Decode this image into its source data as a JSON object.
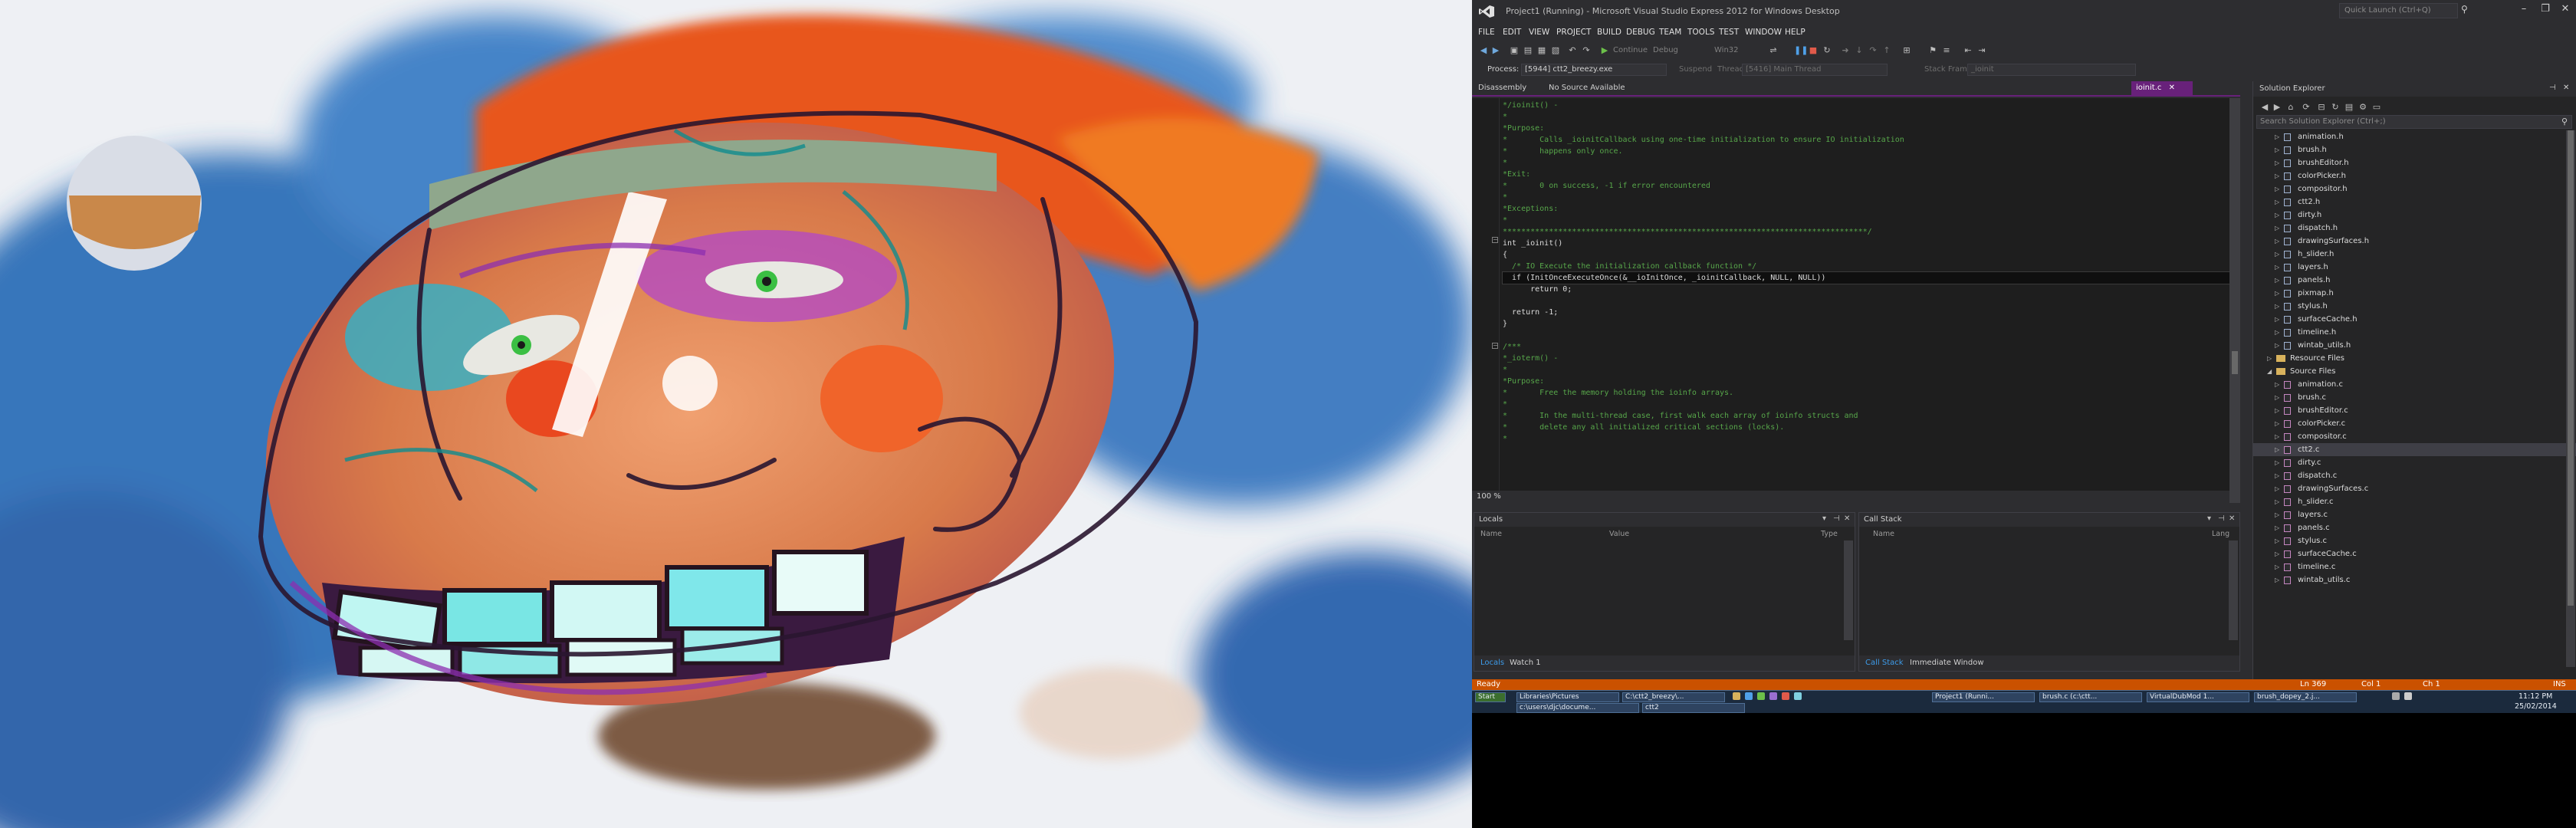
{
  "window": {
    "title": "Project1 (Running) - Microsoft Visual Studio Express 2012 for Windows Desktop",
    "quick_launch_placeholder": "Quick Launch (Ctrl+Q)"
  },
  "menu": [
    "FILE",
    "EDIT",
    "VIEW",
    "PROJECT",
    "BUILD",
    "DEBUG",
    "TEAM",
    "TOOLS",
    "TEST",
    "WINDOW",
    "HELP"
  ],
  "toolbar": {
    "continue_label": "Continue",
    "config": "Debug",
    "platform": "Win32",
    "process_label": "Process:",
    "process_value": "[5944] ctt2_breezy.exe",
    "suspend_label": "Suspend",
    "thread_label": "Thread:",
    "thread_value": "[5416] Main Thread",
    "stack_frame_label": "Stack Frame:",
    "stack_frame_value": "_ioinit"
  },
  "editor": {
    "tabs": [
      "Disassembly",
      "No Source Available"
    ],
    "active_tab": "ioinit.c",
    "zoom": "100 %",
    "lines": [
      {
        "t": "*/ioinit() -",
        "cls": "c-comment"
      },
      {
        "t": "*",
        "cls": "c-comment"
      },
      {
        "t": "*Purpose:",
        "cls": "c-comment"
      },
      {
        "t": "*       Calls _ioinitCallback using one-time initialization to ensure IO initialization",
        "cls": "c-comment"
      },
      {
        "t": "*       happens only once.",
        "cls": "c-comment"
      },
      {
        "t": "*",
        "cls": "c-comment"
      },
      {
        "t": "*Exit:",
        "cls": "c-comment"
      },
      {
        "t": "*       0 on success, -1 if error encountered",
        "cls": "c-comment"
      },
      {
        "t": "*",
        "cls": "c-comment"
      },
      {
        "t": "*Exceptions:",
        "cls": "c-comment"
      },
      {
        "t": "*",
        "cls": "c-comment"
      },
      {
        "t": "*******************************************************************************/",
        "cls": "c-comment"
      },
      {
        "t": "int _ioinit()",
        "cls": "c-plain"
      },
      {
        "t": "{",
        "cls": "c-plain"
      },
      {
        "t": "  /* IO Execute the initialization callback function */",
        "cls": "c-comment"
      },
      {
        "t": "  if (InitOnceExecuteOnce(&__ioInitOnce, _ioinitCallback, NULL, NULL))",
        "cls": "c-plain current-line"
      },
      {
        "t": "      return 0;",
        "cls": "c-plain"
      },
      {
        "t": "",
        "cls": "c-plain"
      },
      {
        "t": "  return -1;",
        "cls": "c-plain"
      },
      {
        "t": "}",
        "cls": "c-plain"
      },
      {
        "t": "",
        "cls": "c-plain"
      },
      {
        "t": "/***",
        "cls": "c-comment"
      },
      {
        "t": "*_ioterm() -",
        "cls": "c-comment"
      },
      {
        "t": "*",
        "cls": "c-comment"
      },
      {
        "t": "*Purpose:",
        "cls": "c-comment"
      },
      {
        "t": "*       Free the memory holding the ioinfo arrays.",
        "cls": "c-comment"
      },
      {
        "t": "*",
        "cls": "c-comment"
      },
      {
        "t": "*       In the multi-thread case, first walk each array of ioinfo structs and",
        "cls": "c-comment"
      },
      {
        "t": "*       delete any all initialized critical sections (locks).",
        "cls": "c-comment"
      },
      {
        "t": "*",
        "cls": "c-comment"
      }
    ]
  },
  "locals": {
    "title": "Locals",
    "columns": [
      "Name",
      "Value",
      "Type"
    ],
    "tabs": [
      "Locals",
      "Watch 1"
    ]
  },
  "callstack": {
    "title": "Call Stack",
    "columns": [
      "Name",
      "Lang"
    ],
    "tabs": [
      "Call Stack",
      "Immediate Window"
    ]
  },
  "solution_explorer": {
    "title": "Solution Explorer",
    "search_placeholder": "Search Solution Explorer (Ctrl+;)",
    "items": [
      {
        "label": "animation.h",
        "type": "h",
        "indent": 1
      },
      {
        "label": "brush.h",
        "type": "h",
        "indent": 1
      },
      {
        "label": "brushEditor.h",
        "type": "h",
        "indent": 1
      },
      {
        "label": "colorPicker.h",
        "type": "h",
        "indent": 1
      },
      {
        "label": "compositor.h",
        "type": "h",
        "indent": 1
      },
      {
        "label": "ctt2.h",
        "type": "h",
        "indent": 1
      },
      {
        "label": "dirty.h",
        "type": "h",
        "indent": 1
      },
      {
        "label": "dispatch.h",
        "type": "h",
        "indent": 1
      },
      {
        "label": "drawingSurfaces.h",
        "type": "h",
        "indent": 1
      },
      {
        "label": "h_slider.h",
        "type": "h",
        "indent": 1
      },
      {
        "label": "layers.h",
        "type": "h",
        "indent": 1
      },
      {
        "label": "panels.h",
        "type": "h",
        "indent": 1
      },
      {
        "label": "pixmap.h",
        "type": "h",
        "indent": 1
      },
      {
        "label": "stylus.h",
        "type": "h",
        "indent": 1
      },
      {
        "label": "surfaceCache.h",
        "type": "h",
        "indent": 1
      },
      {
        "label": "timeline.h",
        "type": "h",
        "indent": 1
      },
      {
        "label": "wintab_utils.h",
        "type": "h",
        "indent": 1
      },
      {
        "label": "Resource Files",
        "type": "folder",
        "indent": 0
      },
      {
        "label": "Source Files",
        "type": "folder",
        "indent": 0,
        "open": true
      },
      {
        "label": "animation.c",
        "type": "c",
        "indent": 1
      },
      {
        "label": "brush.c",
        "type": "c",
        "indent": 1
      },
      {
        "label": "brushEditor.c",
        "type": "c",
        "indent": 1
      },
      {
        "label": "colorPicker.c",
        "type": "c",
        "indent": 1
      },
      {
        "label": "compositor.c",
        "type": "c",
        "indent": 1
      },
      {
        "label": "ctt2.c",
        "type": "c",
        "indent": 1,
        "selected": true
      },
      {
        "label": "dirty.c",
        "type": "c",
        "indent": 1
      },
      {
        "label": "dispatch.c",
        "type": "c",
        "indent": 1
      },
      {
        "label": "drawingSurfaces.c",
        "type": "c",
        "indent": 1
      },
      {
        "label": "h_slider.c",
        "type": "c",
        "indent": 1
      },
      {
        "label": "layers.c",
        "type": "c",
        "indent": 1
      },
      {
        "label": "panels.c",
        "type": "c",
        "indent": 1
      },
      {
        "label": "stylus.c",
        "type": "c",
        "indent": 1
      },
      {
        "label": "surfaceCache.c",
        "type": "c",
        "indent": 1
      },
      {
        "label": "timeline.c",
        "type": "c",
        "indent": 1
      },
      {
        "label": "wintab_utils.c",
        "type": "c",
        "indent": 1
      }
    ]
  },
  "status": {
    "state": "Ready",
    "ln": "Ln 369",
    "col": "Col 1",
    "ch": "Ch 1",
    "mode": "INS"
  },
  "taskbar": {
    "start": "Start",
    "row1": [
      "Libraries\\Pictures",
      "C:\\ctt2_breezy\\...",
      "Project1 (Runni...",
      "brush.c (c:\\ctt...",
      "VirtualDubMod 1...",
      "brush_dopey_2.j..."
    ],
    "row2": [
      "c:\\users\\djc\\docume...",
      "ctt2"
    ],
    "time": "11:12 PM",
    "date": "25/02/2014"
  },
  "colors": {
    "vs_bg": "#2d2d30",
    "editor_bg": "#1e1e1e",
    "accent_purple": "#68217a",
    "status_orange": "#ca5100",
    "comment_green": "#57a64a",
    "keyword_blue": "#569cd6"
  }
}
